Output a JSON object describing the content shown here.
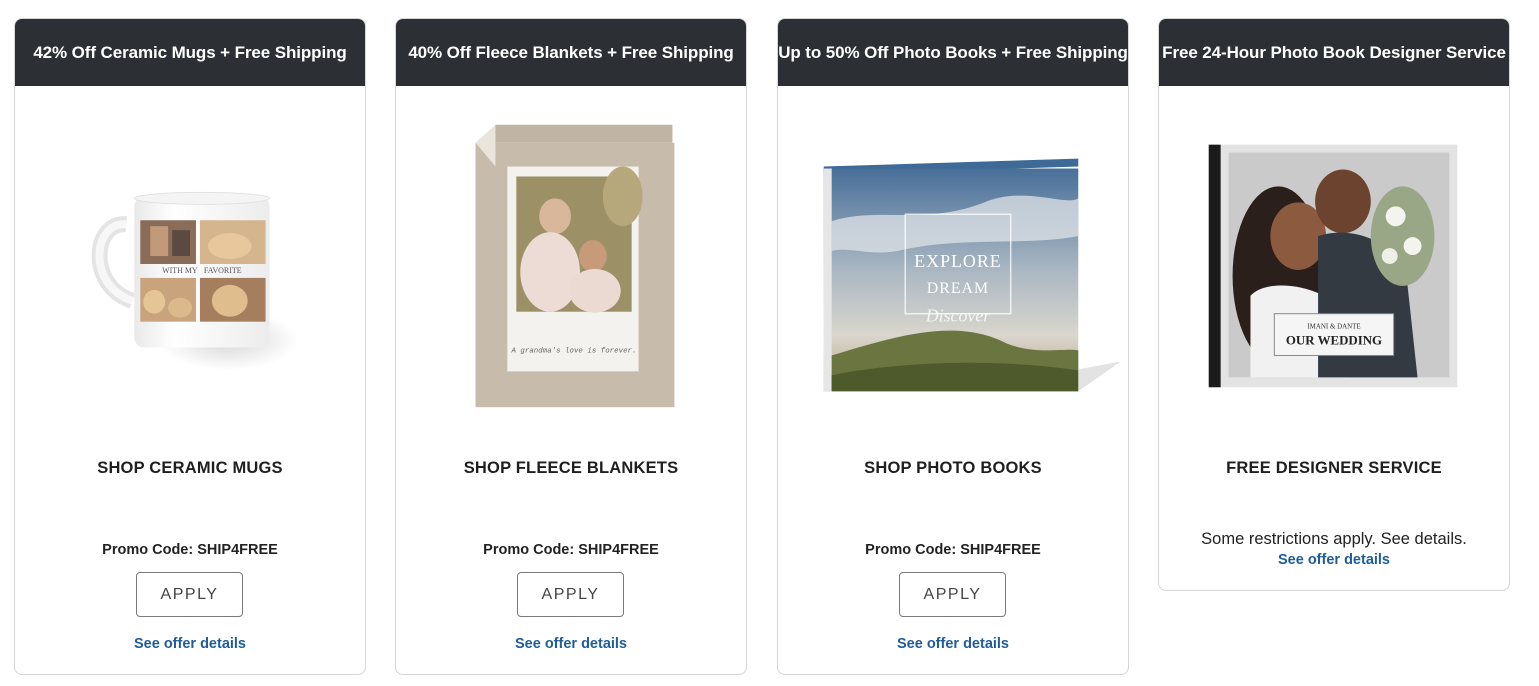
{
  "cards": [
    {
      "header": "42% Off Ceramic Mugs + Free Shipping",
      "image": "ceramic-mug-photo",
      "mug_text_1": "WITH MY",
      "mug_text_2": "FAVORITE",
      "shop_label": "SHOP CERAMIC MUGS",
      "promo": "Promo Code: SHIP4FREE",
      "apply_label": "APPLY",
      "details_link": "See offer details"
    },
    {
      "header": "40% Off Fleece Blankets + Free Shipping",
      "image": "fleece-blanket-photo",
      "caption": "A grandma's love is forever.",
      "shop_label": "SHOP FLEECE BLANKETS",
      "promo": "Promo Code: SHIP4FREE",
      "apply_label": "APPLY",
      "details_link": "See offer details"
    },
    {
      "header": "Up to 50% Off Photo Books + Free Shipping",
      "image": "photo-book-landscape",
      "cover_line_1": "EXPLORE",
      "cover_line_2": "DREAM",
      "cover_line_3": "Discover",
      "shop_label": "SHOP PHOTO BOOKS",
      "promo": "Promo Code: SHIP4FREE",
      "apply_label": "APPLY",
      "details_link": "See offer details"
    },
    {
      "header": "Free 24-Hour Photo Book Designer Service",
      "image": "wedding-photo-book",
      "cover_names": "IMANI & DANTE",
      "cover_title": "OUR WEDDING",
      "shop_label": "FREE DESIGNER SERVICE",
      "restrictions": "Some restrictions apply. See details.",
      "details_link": "See offer details"
    }
  ],
  "colors": {
    "header_bg": "#2c2f33",
    "link": "#1f5c99",
    "border": "#d6d6d6"
  }
}
